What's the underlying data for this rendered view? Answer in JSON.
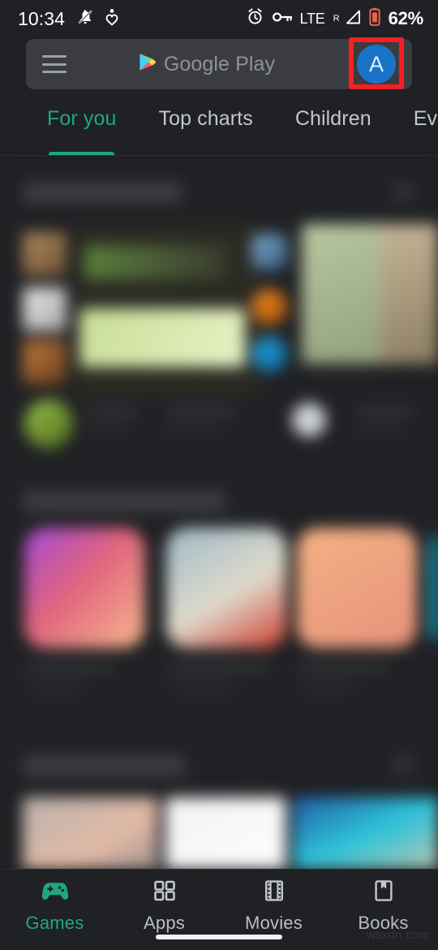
{
  "status_bar": {
    "time": "10:34",
    "icons_left": [
      "bell-slash-icon",
      "heart-pulse-icon"
    ],
    "icons_right": [
      "alarm-icon",
      "vpn-key-icon",
      "signal-icon",
      "battery-icon"
    ],
    "network_label": "LTE",
    "roaming_label": "R",
    "battery_percent": "62%"
  },
  "search_bar": {
    "menu_icon": "hamburger-menu-icon",
    "logo_icon": "google-play-logo-icon",
    "placeholder": "Google Play",
    "avatar_initial": "A",
    "avatar_color": "#1a73c8",
    "highlight_color": "#f81f24"
  },
  "tabs": [
    {
      "label": "For you",
      "active": true
    },
    {
      "label": "Top charts",
      "active": false
    },
    {
      "label": "Children",
      "active": false
    },
    {
      "label": "Even",
      "active": false
    }
  ],
  "bottom_nav": [
    {
      "label": "Games",
      "icon": "gamepad-icon",
      "active": true
    },
    {
      "label": "Apps",
      "icon": "grid-apps-icon",
      "active": false
    },
    {
      "label": "Movies",
      "icon": "film-strip-icon",
      "active": false
    },
    {
      "label": "Books",
      "icon": "book-bookmark-icon",
      "active": false
    }
  ],
  "content_sections": [
    {
      "title": "Offer games",
      "subtitle": "",
      "more": "arrow-more-icon"
    },
    {
      "title": "Suggested for you",
      "subtitle": "",
      "more": ""
    },
    {
      "title": "Casual games",
      "subtitle": "",
      "more": "arrow-more-icon"
    }
  ],
  "theme": {
    "background": "#202124",
    "surface": "#3a3c40",
    "accent_green": "#1ea97c",
    "text_primary": "#ffffff",
    "text_secondary": "#b9bec3"
  },
  "watermark": "wsxdn.com"
}
